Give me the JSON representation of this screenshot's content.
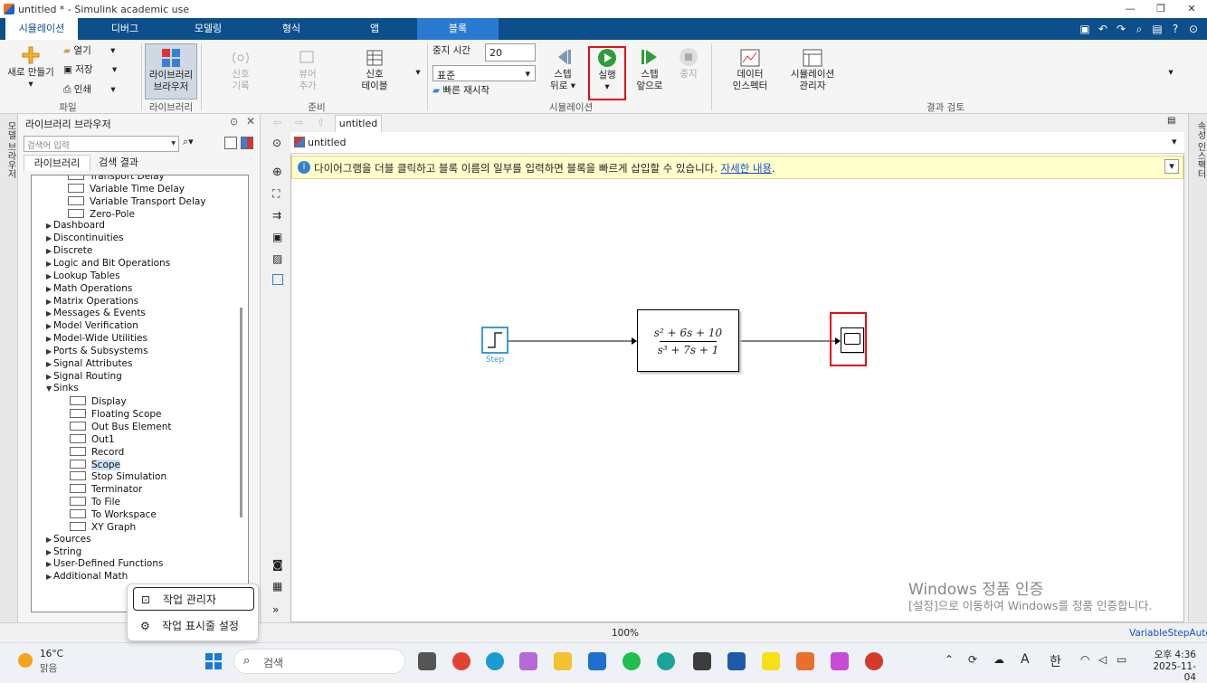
{
  "window": {
    "title": "untitled * - Simulink academic use"
  },
  "tabs": [
    {
      "label": "시뮬레이션"
    },
    {
      "label": "디버그"
    },
    {
      "label": "모델링"
    },
    {
      "label": "형식"
    },
    {
      "label": "앱"
    },
    {
      "label": "블록"
    }
  ],
  "ribbon": {
    "new_label": "새로 만들기",
    "open_label": "열기",
    "save_label": "저장",
    "print_label": "인쇄",
    "file_section": "파일",
    "library_browser_label": "라이브러리\n브라우저",
    "library_section": "라이브러리",
    "signal_log_label": "신호\n기록",
    "viewer_add_label": "뷰어\n추가",
    "signal_table_label": "신호\n테이블",
    "prepare_section": "준비",
    "stop_time_label": "중지 시간",
    "stop_time_value": "20",
    "mode_value": "표준",
    "fast_restart_label": "빠른 재시작",
    "step_back_label": "스텝\n뒤로",
    "run_label": "실행",
    "step_forward_label": "스텝\n앞으로",
    "stop_label": "중지",
    "simulation_section": "시뮬레이션",
    "data_inspector_label": "데이터\n인스펙터",
    "sim_manager_label": "시뮬레이션\n관리자",
    "review_section": "결과 검토"
  },
  "library": {
    "title": "라이브러리 브라우저",
    "search_placeholder": "검색어 입력",
    "tab_library": "라이브러리",
    "tab_results": "검색 결과",
    "items": [
      {
        "label": "Transport Delay",
        "level": 2,
        "expand": ""
      },
      {
        "label": "Variable Time Delay",
        "level": 2,
        "expand": ""
      },
      {
        "label": "Variable Transport Delay",
        "level": 2,
        "expand": ""
      },
      {
        "label": "Zero-Pole",
        "level": 2,
        "expand": ""
      },
      {
        "label": "Dashboard",
        "level": 1,
        "expand": "▶"
      },
      {
        "label": "Discontinuities",
        "level": 1,
        "expand": "▶"
      },
      {
        "label": "Discrete",
        "level": 1,
        "expand": "▶"
      },
      {
        "label": "Logic and Bit Operations",
        "level": 1,
        "expand": "▶"
      },
      {
        "label": "Lookup Tables",
        "level": 1,
        "expand": "▶"
      },
      {
        "label": "Math Operations",
        "level": 1,
        "expand": "▶"
      },
      {
        "label": "Matrix Operations",
        "level": 1,
        "expand": "▶"
      },
      {
        "label": "Messages & Events",
        "level": 1,
        "expand": "▶"
      },
      {
        "label": "Model Verification",
        "level": 1,
        "expand": "▶"
      },
      {
        "label": "Model-Wide Utilities",
        "level": 1,
        "expand": "▶"
      },
      {
        "label": "Ports & Subsystems",
        "level": 1,
        "expand": "▶"
      },
      {
        "label": "Signal Attributes",
        "level": 1,
        "expand": "▶"
      },
      {
        "label": "Signal Routing",
        "level": 1,
        "expand": "▶"
      },
      {
        "label": "Sinks",
        "level": 1,
        "expand": "▼"
      },
      {
        "label": "Display",
        "level": 3,
        "expand": ""
      },
      {
        "label": "Floating Scope",
        "level": 3,
        "expand": ""
      },
      {
        "label": "Out Bus Element",
        "level": 3,
        "expand": ""
      },
      {
        "label": "Out1",
        "level": 3,
        "expand": ""
      },
      {
        "label": "Record",
        "level": 3,
        "expand": ""
      },
      {
        "label": "Scope",
        "level": 3,
        "expand": ""
      },
      {
        "label": "Stop Simulation",
        "level": 3,
        "expand": ""
      },
      {
        "label": "Terminator",
        "level": 3,
        "expand": ""
      },
      {
        "label": "To File",
        "level": 3,
        "expand": ""
      },
      {
        "label": "To Workspace",
        "level": 3,
        "expand": ""
      },
      {
        "label": "XY Graph",
        "level": 3,
        "expand": ""
      },
      {
        "label": "Sources",
        "level": 1,
        "expand": "▶"
      },
      {
        "label": "String",
        "level": 1,
        "expand": "▶"
      },
      {
        "label": "User-Defined Functions",
        "level": 1,
        "expand": "▶"
      },
      {
        "label": "Additional Math",
        "level": 1,
        "expand": "▶"
      }
    ]
  },
  "side_strips": {
    "left": "모델 브라우저",
    "right": "속성 인스펙터"
  },
  "editor": {
    "tab_label": "untitled",
    "address": "untitled",
    "banner_text": "다이어그램을 더블 클릭하고 블록 이름의 일부를 입력하면 블록을 빠르게 삽입할 수 있습니다.",
    "banner_link": "자세한 내용",
    "banner_dot": "."
  },
  "diagram": {
    "step_label": "Step",
    "tf_numerator": "s² + 6s + 10",
    "tf_denominator": "s³ + 7s + 1"
  },
  "watermark": {
    "title": "Windows 정품 인증",
    "subtitle": "[설정]으로 이동하여 Windows를 정품 인증합니다."
  },
  "status": {
    "zoom": "100%",
    "solver": "VariableStepAuto"
  },
  "context_menu": {
    "item1": "작업 관리자",
    "item2": "작업 표시줄 설정"
  },
  "taskbar": {
    "temperature": "16°C",
    "weather": "맑음",
    "search_placeholder": "검색",
    "ime_a": "A",
    "ime_han": "한",
    "time": "오후 4:36",
    "date": "2025-11-04"
  },
  "colors": {
    "tabbar_bg": "#0d4f8b",
    "highlight_red": "#e0101a",
    "banner_bg": "#ffffcc",
    "run_green": "#2e9e3a"
  }
}
